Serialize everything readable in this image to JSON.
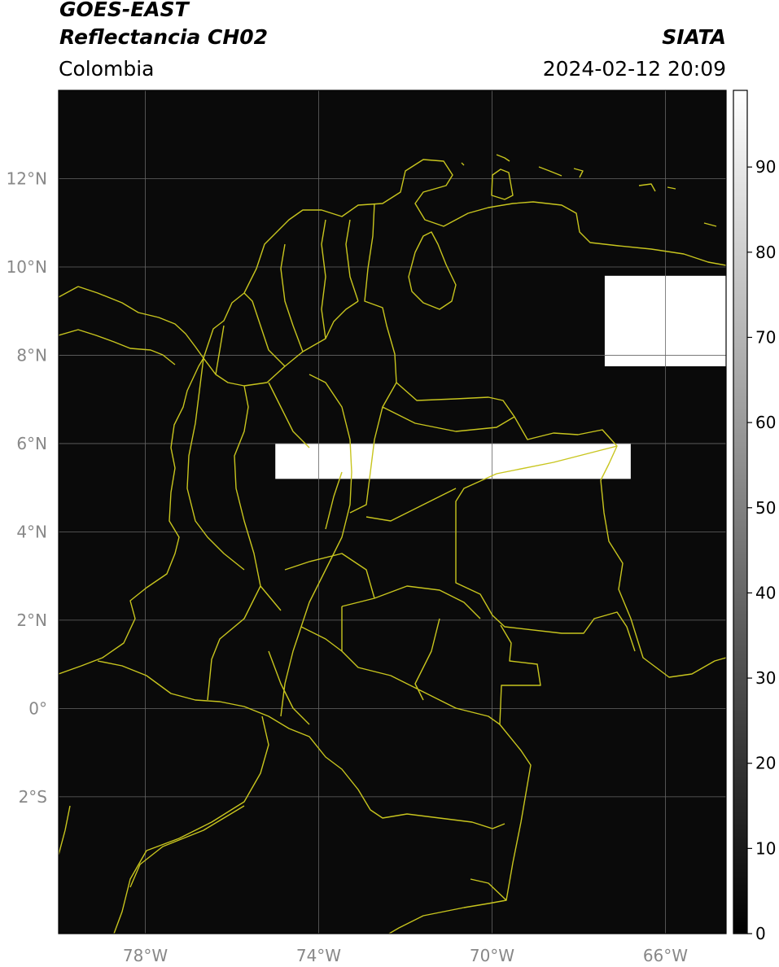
{
  "header": {
    "title_line1": "GOES-EAST",
    "title_line2": "Reflectancia CH02",
    "region": "Colombia",
    "organization": "SIATA",
    "datetime": "2024-02-12 20:09"
  },
  "map": {
    "lon_range": [
      -80,
      -64.6
    ],
    "lat_range": [
      -5.1,
      14.0
    ],
    "background_color": "#0a0a0a",
    "border_color": "#c8c51e",
    "grid_color": "#666666",
    "lat_ticks": [
      {
        "value": 12,
        "label": "12°N"
      },
      {
        "value": 10,
        "label": "10°N"
      },
      {
        "value": 8,
        "label": "8°N"
      },
      {
        "value": 6,
        "label": "6°N"
      },
      {
        "value": 4,
        "label": "4°N"
      },
      {
        "value": 2,
        "label": "2°N"
      },
      {
        "value": 0,
        "label": "0°"
      },
      {
        "value": -2,
        "label": "2°S"
      }
    ],
    "lon_ticks": [
      {
        "value": -78,
        "label": "78°W"
      },
      {
        "value": -74,
        "label": "74°W"
      },
      {
        "value": -70,
        "label": "70°W"
      },
      {
        "value": -66,
        "label": "66°W"
      }
    ],
    "bright_areas": [
      {
        "lon": [
          -75.0,
          -66.8
        ],
        "lat": [
          5.2,
          6.0
        ]
      },
      {
        "lon": [
          -67.4,
          -64.6
        ],
        "lat": [
          7.75,
          9.8
        ]
      }
    ]
  },
  "colorbar": {
    "min": 0,
    "max": 99,
    "ticks": [
      {
        "value": 0,
        "label": "0"
      },
      {
        "value": 10,
        "label": "10"
      },
      {
        "value": 20,
        "label": "20"
      },
      {
        "value": 30,
        "label": "30"
      },
      {
        "value": 40,
        "label": "40"
      },
      {
        "value": 50,
        "label": "50"
      },
      {
        "value": 60,
        "label": "60"
      },
      {
        "value": 70,
        "label": "70"
      },
      {
        "value": 80,
        "label": "80"
      },
      {
        "value": 90,
        "label": "90"
      }
    ]
  }
}
